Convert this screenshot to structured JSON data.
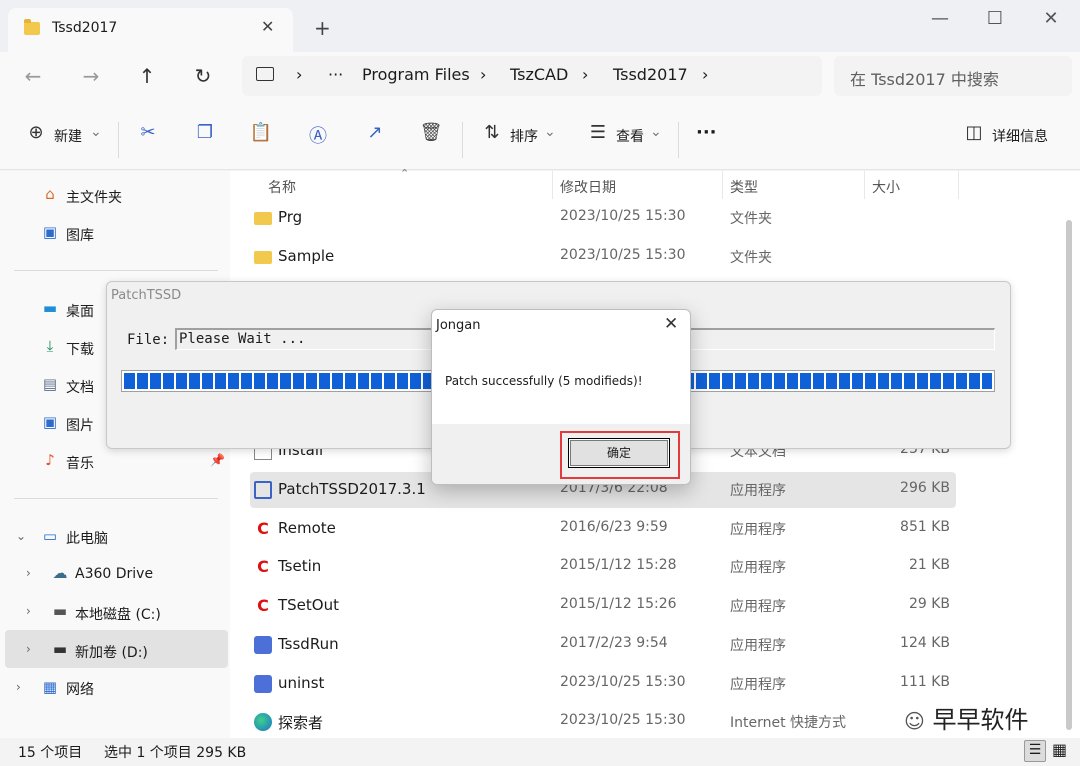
{
  "tab": {
    "title": "Tssd2017",
    "close": "✕",
    "new": "+"
  },
  "window": {
    "minimize": "—",
    "maximize": "☐",
    "close": "✕"
  },
  "nav": {
    "back": "←",
    "forward": "→",
    "up": "↑",
    "refresh": "↻"
  },
  "address": {
    "sep": "›",
    "more": "···",
    "segments": [
      "Program Files",
      "TszCAD",
      "Tssd2017"
    ],
    "search_placeholder": "在 Tssd2017 中搜索"
  },
  "toolbar": {
    "new_label": "新建",
    "sort_label": "排序",
    "view_label": "查看",
    "more": "···",
    "details_label": "详细信息",
    "chev": "⌄"
  },
  "sidebar": {
    "pinned": [
      {
        "label": "主文件夹",
        "icon": "home-icon"
      },
      {
        "label": "图库",
        "icon": "gallery-icon"
      }
    ],
    "quick": [
      {
        "label": "桌面"
      },
      {
        "label": "下载"
      },
      {
        "label": "文档"
      },
      {
        "label": "图片"
      },
      {
        "label": "音乐"
      }
    ],
    "pc": [
      {
        "label": "此电脑"
      },
      {
        "label": "A360 Drive"
      },
      {
        "label": "本地磁盘 (C:)"
      },
      {
        "label": "新加卷 (D:)"
      },
      {
        "label": "网络"
      }
    ]
  },
  "columns": {
    "name": "名称",
    "date": "修改日期",
    "type": "类型",
    "size": "大小"
  },
  "files": [
    {
      "name": "Prg",
      "date": "2023/10/25 15:30",
      "type": "文件夹",
      "size": "",
      "icon": "folder"
    },
    {
      "name": "Sample",
      "date": "2023/10/25 15:30",
      "type": "文件夹",
      "size": "",
      "icon": "folder"
    },
    {
      "name": "Install",
      "date": "",
      "type": "文本文档",
      "size": "237 KB",
      "icon": "doc"
    },
    {
      "name": "PatchTSSD2017.3.1",
      "date": "2017/3/6 22:08",
      "type": "应用程序",
      "size": "296 KB",
      "icon": "app"
    },
    {
      "name": "Remote",
      "date": "2016/6/23 9:59",
      "type": "应用程序",
      "size": "851 KB",
      "icon": "red"
    },
    {
      "name": "Tsetin",
      "date": "2015/1/12 15:28",
      "type": "应用程序",
      "size": "21 KB",
      "icon": "red"
    },
    {
      "name": "TSetOut",
      "date": "2015/1/12 15:26",
      "type": "应用程序",
      "size": "29 KB",
      "icon": "red"
    },
    {
      "name": "TssdRun",
      "date": "2017/2/23 9:54",
      "type": "应用程序",
      "size": "124 KB",
      "icon": "blue"
    },
    {
      "name": "uninst",
      "date": "2023/10/25 15:30",
      "type": "应用程序",
      "size": "111 KB",
      "icon": "blue"
    },
    {
      "name": "探索者",
      "date": "2023/10/25 15:30",
      "type": "Internet 快捷方式",
      "size": "",
      "icon": "edge"
    }
  ],
  "status": {
    "count": "15 个项目",
    "selected": "选中 1 个项目 295 KB"
  },
  "patch": {
    "title": "PatchTSSD",
    "file_label": "File:",
    "file_value": "Please Wait ...",
    "progress": 1.0
  },
  "dialog": {
    "title": "Jongan",
    "close": "✕",
    "message": "Patch successfully (5 modifieds)!",
    "ok": "确定"
  },
  "watermark": "早早软件",
  "colors": {
    "accent": "#1060d8",
    "highlight_border": "#e23b3b",
    "folder": "#f2c94c"
  }
}
